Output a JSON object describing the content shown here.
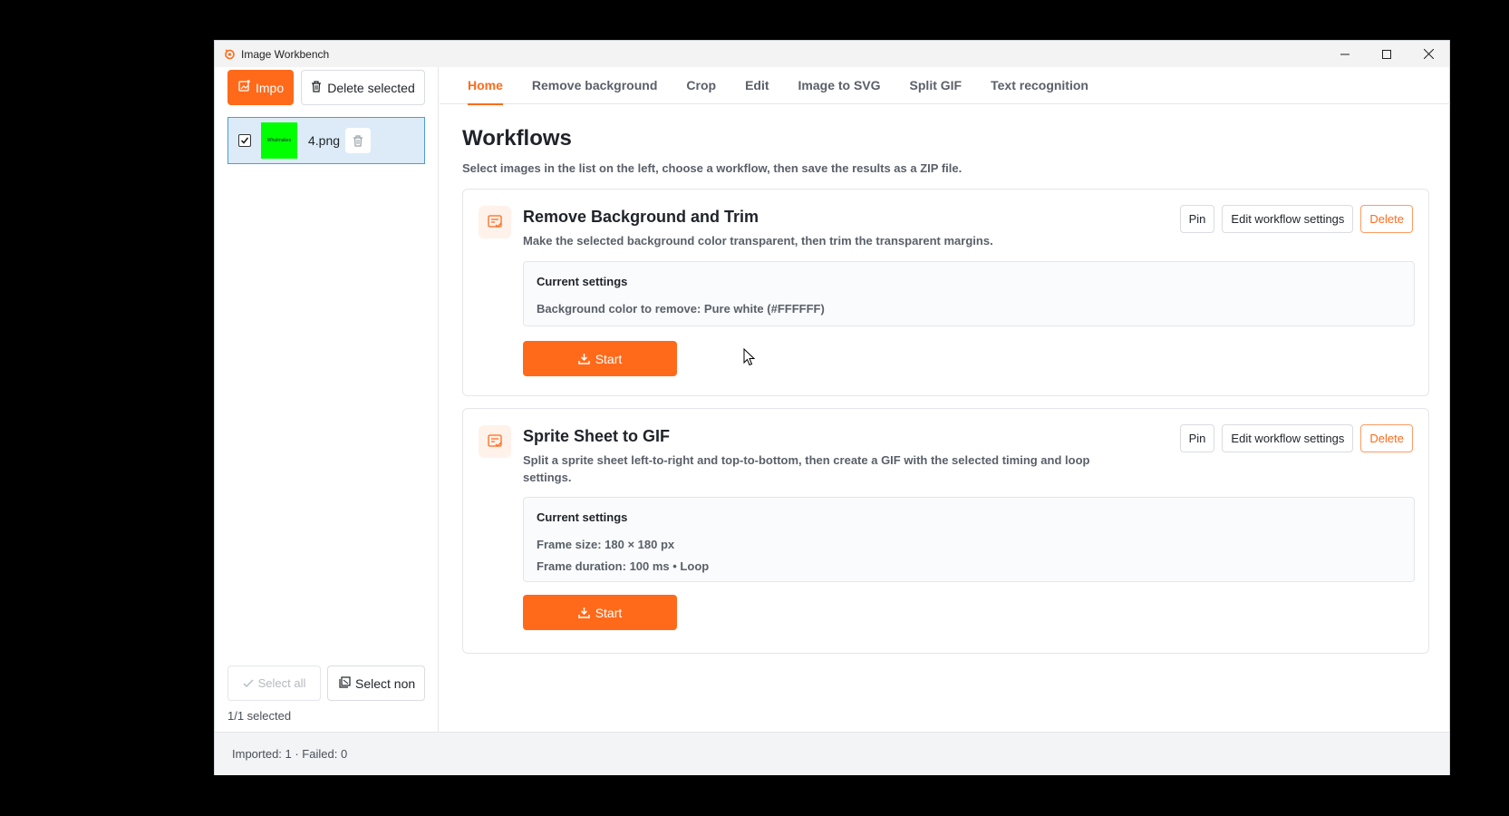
{
  "window": {
    "title": "Image Workbench"
  },
  "sidebar": {
    "import_label": "Impo",
    "delete_selected_label": "Delete selected",
    "files": [
      {
        "name": "4.png",
        "checked": true,
        "thumb_text": "Whatmakes"
      }
    ],
    "select_all_label": "Select all",
    "select_none_label": "Select non",
    "selection_count": "1/1 selected"
  },
  "tabs": [
    "Home",
    "Remove background",
    "Crop",
    "Edit",
    "Image to SVG",
    "Split GIF",
    "Text recognition"
  ],
  "main": {
    "title": "Workflows",
    "subtitle": "Select images in the list on the left, choose a workflow, then save the results as a ZIP file."
  },
  "workflows": [
    {
      "title": "Remove Background and Trim",
      "description": "Make the selected background color transparent, then trim the transparent margins.",
      "pin_label": "Pin",
      "edit_label": "Edit workflow settings",
      "delete_label": "Delete",
      "settings_heading": "Current settings",
      "settings": [
        "Background color to remove: Pure white (#FFFFFF)"
      ],
      "start_label": "Start"
    },
    {
      "title": "Sprite Sheet to GIF",
      "description": "Split a sprite sheet left-to-right and top-to-bottom, then create a GIF with the selected timing and loop settings.",
      "pin_label": "Pin",
      "edit_label": "Edit workflow settings",
      "delete_label": "Delete",
      "settings_heading": "Current settings",
      "settings": [
        "Frame size: 180 × 180 px",
        "Frame duration: 100 ms • Loop"
      ],
      "start_label": "Start"
    }
  ],
  "status": {
    "text": "Imported: 1 · Failed: 0"
  },
  "colors": {
    "accent": "#ff6a1a",
    "selection_bg": "#dcebf7",
    "selection_border": "#4a9cdc"
  },
  "icons": [
    "app-icon",
    "import-icon",
    "trash-icon",
    "checkmark-icon",
    "select-none-icon",
    "workflow-icon",
    "download-icon",
    "minimize-icon",
    "maximize-icon",
    "close-icon"
  ]
}
